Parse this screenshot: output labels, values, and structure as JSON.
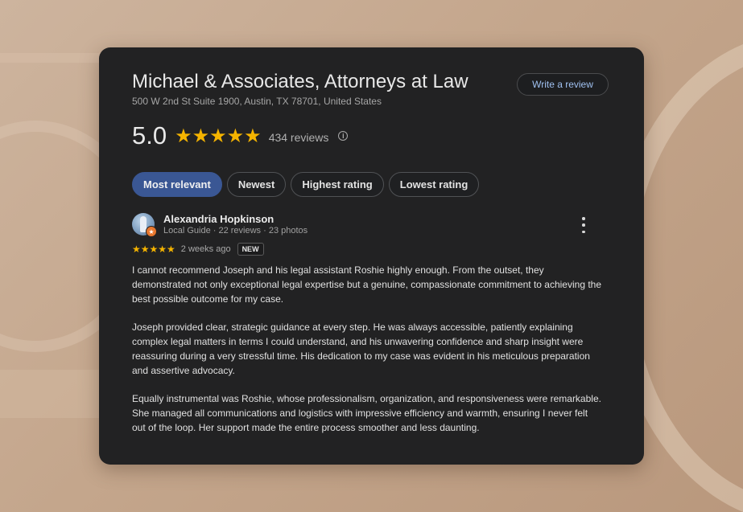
{
  "business": {
    "name": "Michael & Associates, Attorneys at Law",
    "address": "500 W 2nd St Suite 1900, Austin, TX 78701, United States",
    "write_review_label": "Write a review",
    "rating": "5.0",
    "stars": "★★★★★",
    "review_count": "434 reviews",
    "info_glyph": "i"
  },
  "sort_chips": [
    {
      "label": "Most relevant",
      "active": true
    },
    {
      "label": "Newest",
      "active": false
    },
    {
      "label": "Highest rating",
      "active": false
    },
    {
      "label": "Lowest rating",
      "active": false
    }
  ],
  "review": {
    "author": "Alexandria Hopkinson",
    "author_meta": "Local Guide · 22 reviews · 23 photos",
    "stars": "★★★★★",
    "rating": 5,
    "date": "2 weeks ago",
    "badge": "NEW",
    "paragraphs": [
      "I cannot recommend Joseph and his legal assistant Roshie highly enough. From the outset, they demonstrated not only exceptional legal expertise but a genuine, compassionate commitment to achieving the best possible outcome for my case.",
      "Joseph provided clear, strategic guidance at every step. He was always accessible, patiently explaining complex legal matters in terms I could understand, and his unwavering confidence and sharp insight were reassuring during a very stressful time. His dedication to my case was evident in his meticulous preparation and assertive advocacy.",
      "Equally instrumental was Roshie, whose professionalism, organization, and responsiveness were remarkable. She managed all communications and logistics with impressive efficiency and warmth, ensuring I never felt out of the loop. Her support made the entire process smoother and less daunting."
    ]
  },
  "icons": {
    "info": "info-icon",
    "more": "more-vert-icon",
    "local_guide": "local-guide-badge-icon"
  },
  "colors": {
    "card_background": "#222223",
    "star": "#f5b400",
    "active_chip": "#3a5794",
    "link": "#9fc0f0"
  }
}
